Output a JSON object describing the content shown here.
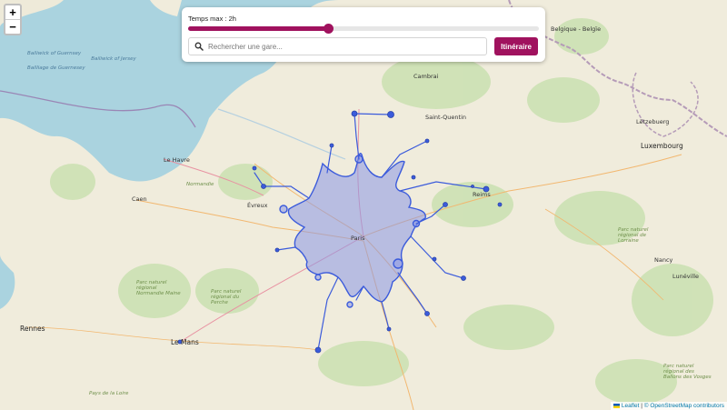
{
  "controls": {
    "slider_label": "Temps max : 2h",
    "slider_level": 0.4,
    "search_placeholder": "Rechercher une gare...",
    "itinerary_label": "Itinéraire"
  },
  "zoom": {
    "zoom_in": "+",
    "zoom_out": "−"
  },
  "attribution": {
    "leaflet": "Leaflet",
    "separator": " | ",
    "osm": "© OpenStreetMap contributors"
  },
  "map_labels": {
    "bailiwick_guernsey": "Bailiwick of Guernsey",
    "bailliage_guernesey": "Bailliage de Guernesey",
    "bailiwick_jersey": "Bailiwick of Jersey",
    "le_havre": "Le Havre",
    "caen": "Caen",
    "rennes": "Rennes",
    "le_mans": "Le Mans",
    "paris": "Paris",
    "reims": "Reims",
    "luxembourg": "Luxembourg",
    "letzebuerg": "Lëtzebuerg",
    "nancy": "Nancy",
    "belgique": "Belgique - Belgïe",
    "pays_de_la_loire": "Pays de la Loire",
    "normandie": "Normandie",
    "parc_normandie_maine": "Parc naturel régional Normandie Maine",
    "parc_perche": "Parc naturel régional du Perche",
    "parc_lorraine": "Parc naturel régional de Lorraine",
    "parc_vosges": "Parc naturel régional des Ballons des Vosges",
    "cambrai": "Cambrai",
    "saint_quentin": "Saint-Quentin",
    "luneville": "Lunéville",
    "evreux": "Évreux"
  },
  "accent_color": "#a0125e",
  "isochrone_color": "#3b5bdb"
}
